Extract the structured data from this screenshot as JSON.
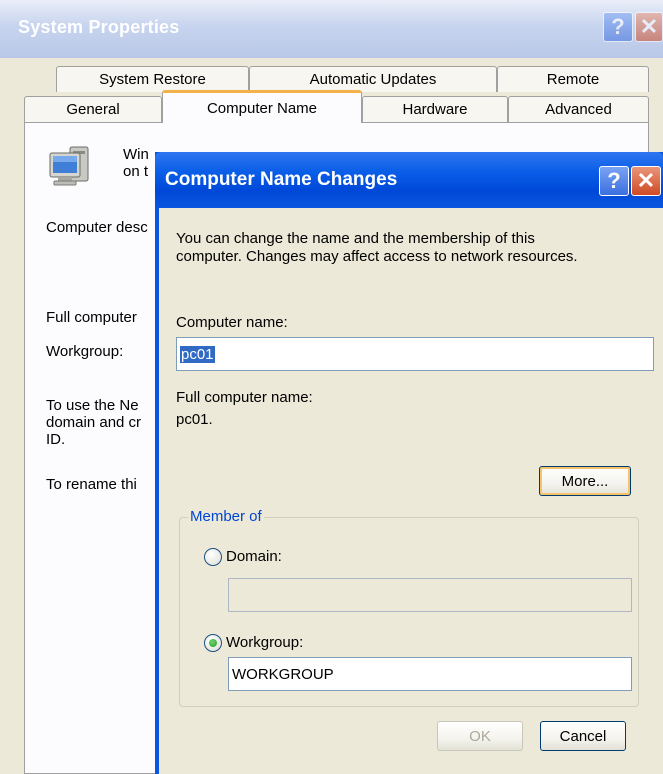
{
  "system_properties": {
    "title": "System Properties",
    "help_glyph": "?",
    "close_glyph": "✕",
    "tabs_row1": [
      "System Restore",
      "Automatic Updates",
      "Remote"
    ],
    "tabs_row2": [
      "General",
      "Computer Name",
      "Hardware",
      "Advanced"
    ],
    "active_tab": "Computer Name",
    "panel": {
      "intro_line1": "Win",
      "intro_line2": "on t",
      "computer_description_label": "Computer desc",
      "full_computer_label": "Full computer",
      "workgroup_label": "Workgroup:",
      "network_text_line1": "To use the Ne",
      "network_text_line2": "domain and cr",
      "network_text_line3": "ID.",
      "rename_text": "To rename thi"
    }
  },
  "dialog": {
    "title": "Computer Name Changes",
    "help_glyph": "?",
    "close_glyph": "✕",
    "description_line1": "You can change the name and the membership of this",
    "description_line2": "computer. Changes may affect access to network resources.",
    "computer_name_label": "Computer name:",
    "computer_name_value": "pc01",
    "full_name_label": "Full computer name:",
    "full_name_value": "pc01.",
    "more_button": "More...",
    "member_of_legend": "Member of",
    "domain_label": "Domain:",
    "domain_value": "",
    "domain_selected": false,
    "workgroup_label": "Workgroup:",
    "workgroup_value": "WORKGROUP",
    "workgroup_selected": true,
    "ok_button": "OK",
    "cancel_button": "Cancel"
  },
  "colors": {
    "dialog_title_blue": "#0a56e0",
    "window_face": "#ece9d8",
    "group_legend_blue": "#0046d5",
    "selection_blue": "#316ac5",
    "tab_highlight": "#f3b249"
  }
}
